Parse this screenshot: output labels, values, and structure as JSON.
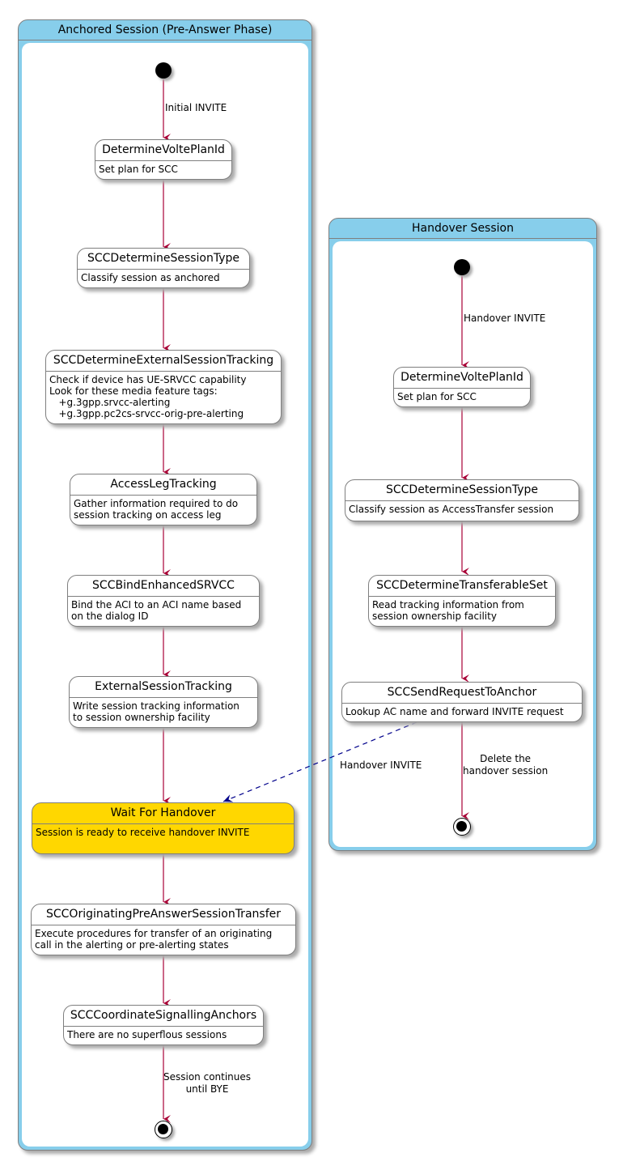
{
  "colors": {
    "composite_header": "#87ceeb",
    "state_fill": "#ffffff",
    "highlight_fill": "#ffd700",
    "edge": "#a80036",
    "cross_edge": "#00008b",
    "border": "#7f7f7f"
  },
  "anchored": {
    "title": "Anchored Session (Pre-Answer Phase)",
    "states": [
      {
        "name": "DetermineVoltePlanId",
        "desc": "Set plan for SCC"
      },
      {
        "name": "SCCDetermineSessionType",
        "desc": "Classify session as anchored"
      },
      {
        "name": "SCCDetermineExternalSessionTracking",
        "desc": "Check if device has UE-SRVCC capability\nLook for these media feature tags:\n   +g.3gpp.srvcc-alerting\n   +g.3gpp.pc2cs-srvcc-orig-pre-alerting"
      },
      {
        "name": "AccessLegTracking",
        "desc": "Gather information required to do\nsession tracking on access leg"
      },
      {
        "name": "SCCBindEnhancedSRVCC",
        "desc": "Bind the ACI to an ACI name based\non the dialog ID"
      },
      {
        "name": "ExternalSessionTracking",
        "desc": "Write session tracking information\nto session ownership facility"
      },
      {
        "name": "Wait For Handover",
        "desc": "Session is ready to receive handover INVITE"
      },
      {
        "name": "SCCOriginatingPreAnswerSessionTransfer",
        "desc": "Execute procedures for transfer of an originating\ncall in the alerting or pre-alerting states"
      },
      {
        "name": "SCCCoordinateSignallingAnchors",
        "desc": "There are no superflous sessions"
      }
    ],
    "edge_labels": {
      "initial": "Initial INVITE",
      "final": "Session continues\nuntil BYE"
    }
  },
  "handover": {
    "title": "Handover Session",
    "states": [
      {
        "name": "DetermineVoltePlanId",
        "desc": "Set plan for SCC"
      },
      {
        "name": "SCCDetermineSessionType",
        "desc": "Classify session as AccessTransfer session"
      },
      {
        "name": "SCCDetermineTransferableSet",
        "desc": "Read tracking information from\nsession ownership facility"
      },
      {
        "name": "SCCSendRequestToAnchor",
        "desc": "Lookup AC name and forward INVITE request"
      }
    ],
    "edge_labels": {
      "initial": "Handover INVITE",
      "final": "Delete the\nhandover session"
    }
  },
  "cross_edge_label": "Handover INVITE"
}
